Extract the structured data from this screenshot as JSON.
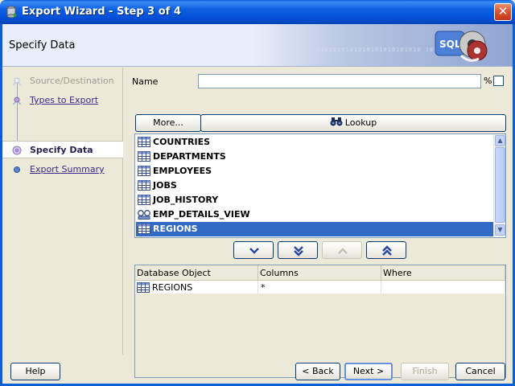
{
  "window": {
    "title": "Export Wizard - Step 3 of 4",
    "close_glyph": "✕"
  },
  "banner": {
    "title": "Specify Data",
    "binary_text": "0101010101010101010101010 101010",
    "art_text": "SQL"
  },
  "nav": {
    "items": [
      {
        "label": "Source/Destination",
        "state": "disabled"
      },
      {
        "label": "Types to Export",
        "state": "link"
      },
      {
        "label": "Specify Data",
        "state": "current"
      },
      {
        "label": "Export Summary",
        "state": "link"
      }
    ]
  },
  "filter": {
    "name_label": "Name",
    "name_value": "",
    "wildcard": "%",
    "more_label": "More...",
    "lookup_label": "Lookup"
  },
  "objects": [
    {
      "name": "COUNTRIES",
      "icon": "table-icon"
    },
    {
      "name": "DEPARTMENTS",
      "icon": "table-icon"
    },
    {
      "name": "EMPLOYEES",
      "icon": "table-icon"
    },
    {
      "name": "JOBS",
      "icon": "table-icon"
    },
    {
      "name": "JOB_HISTORY",
      "icon": "table-icon"
    },
    {
      "name": "EMP_DETAILS_VIEW",
      "icon": "view-icon"
    },
    {
      "name": "REGIONS",
      "icon": "table-icon",
      "selected": true
    }
  ],
  "move_buttons": [
    {
      "name": "move-down-button",
      "icon": "chevron-down-icon",
      "enabled": true
    },
    {
      "name": "move-all-down-button",
      "icon": "double-chevron-down-icon",
      "enabled": true
    },
    {
      "name": "move-up-button",
      "icon": "chevron-up-icon",
      "enabled": false
    },
    {
      "name": "move-all-up-button",
      "icon": "double-chevron-up-icon",
      "enabled": true
    }
  ],
  "selected_table": {
    "columns": [
      "Database Object",
      "Columns",
      "Where"
    ],
    "rows": [
      {
        "object": "REGIONS",
        "columns": "*",
        "where": ""
      }
    ]
  },
  "buttons": {
    "help": "Help",
    "back": "< Back",
    "next": "Next >",
    "finish": "Finish",
    "cancel": "Cancel"
  },
  "colors": {
    "titlebar": "#0b5fe0",
    "selection": "#316ac5",
    "nav_link": "#3a2a8a"
  }
}
